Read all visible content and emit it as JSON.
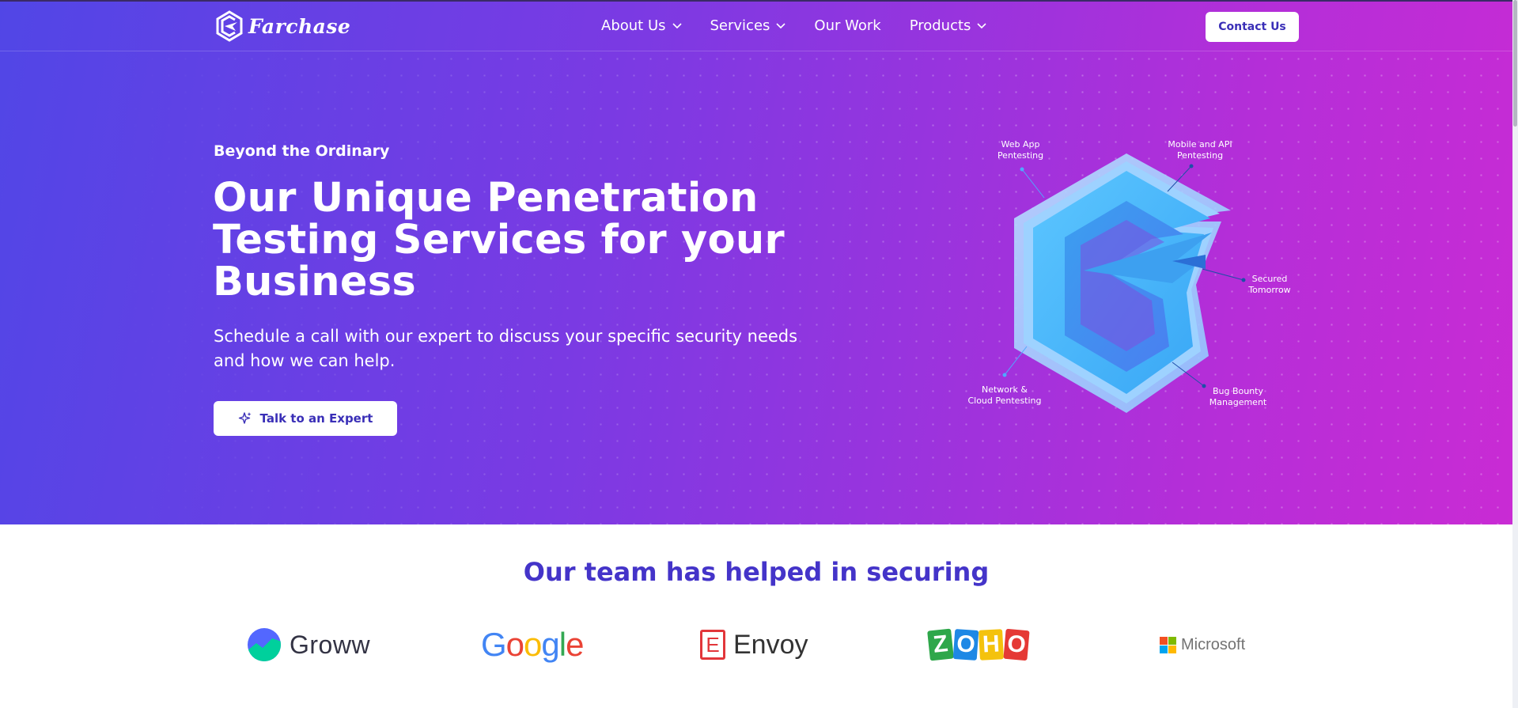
{
  "nav": {
    "logo_text": "Farchase",
    "items": [
      {
        "label": "About Us",
        "dropdown": true
      },
      {
        "label": "Services",
        "dropdown": true
      },
      {
        "label": "Our Work",
        "dropdown": false
      },
      {
        "label": "Products",
        "dropdown": true
      }
    ],
    "contact_label": "Contact Us"
  },
  "hero": {
    "eyebrow": "Beyond the Ordinary",
    "headline": "Our Unique Penetration Testing Services for your Business",
    "subtext": "Schedule a call with our expert to discuss your specific security needs and how we can help.",
    "cta_label": "Talk to an Expert",
    "illustration_labels": {
      "web_app": "Web App\nPentesting",
      "mobile_api": "Mobile and API\nPentesting",
      "secured": "Secured\nTomorrow",
      "bug_bounty": "Bug Bounty\nManagement",
      "network_cloud": "Network &\nCloud Pentesting"
    }
  },
  "clients": {
    "title": "Our team has helped in securing",
    "logos": {
      "groww": "Groww",
      "google": [
        "G",
        "o",
        "o",
        "g",
        "l",
        "e"
      ],
      "envoy": "Envoy",
      "envoy_mark": "E",
      "zoho": [
        "Z",
        "O",
        "H",
        "O"
      ],
      "microsoft": "Microsoft"
    }
  },
  "colors": {
    "brand_purple": "#4434c9",
    "gradient_start": "#5146e6",
    "gradient_end": "#c92bd4",
    "google": [
      "#4285F4",
      "#EA4335",
      "#FBBC05",
      "#4285F4",
      "#34A853",
      "#EA4335"
    ],
    "zoho": [
      "#2ea74a",
      "#1e88e5",
      "#f4c20d",
      "#e53935"
    ],
    "microsoft": [
      "#f25022",
      "#7fba00",
      "#00a4ef",
      "#ffb900"
    ]
  }
}
